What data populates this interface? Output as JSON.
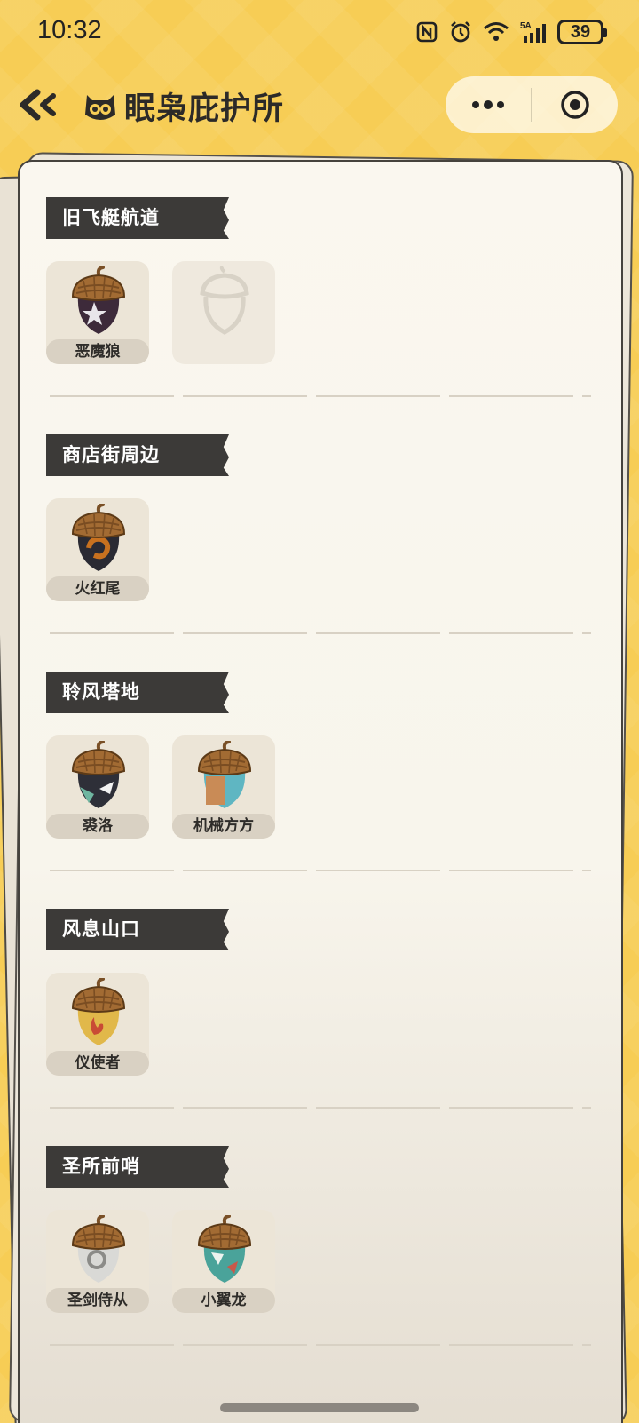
{
  "status_bar": {
    "time": "10:32",
    "signal_label": "5A",
    "battery": "39",
    "icons": [
      "nfc-icon",
      "alarm-icon",
      "wifi-icon",
      "cellular-icon",
      "battery-icon"
    ]
  },
  "header": {
    "title": "眠枭庇护所",
    "back_icon": "double-chevron-left-icon",
    "title_icon": "owl-icon",
    "capsule": {
      "more_icon": "more-dots-icon",
      "close_icon": "target-close-icon"
    }
  },
  "colors": {
    "background": "#f7cd55",
    "paper": "#f8f5ec",
    "section_tag": "#3c3a38",
    "card": "#ece5d7"
  },
  "sections": [
    {
      "title": "旧飞艇航道",
      "items": [
        {
          "name": "恶魔狼",
          "collected": true,
          "body_colors": [
            "#3d2a3a",
            "#6b2f3c"
          ],
          "emblem": "star"
        },
        {
          "name": "",
          "collected": false
        }
      ]
    },
    {
      "title": "商店街周边",
      "items": [
        {
          "name": "火红尾",
          "collected": true,
          "body_colors": [
            "#2a2a33",
            "#c8711f"
          ],
          "emblem": "swirl"
        }
      ]
    },
    {
      "title": "聆风塔地",
      "items": [
        {
          "name": "裘洛",
          "collected": true,
          "body_colors": [
            "#2e2f38",
            "#6fb6a0"
          ],
          "emblem": "cape"
        },
        {
          "name": "机械方方",
          "collected": true,
          "body_colors": [
            "#5fb6c2",
            "#c98b56"
          ],
          "emblem": "patch"
        }
      ]
    },
    {
      "title": "风息山口",
      "items": [
        {
          "name": "仪使者",
          "collected": true,
          "body_colors": [
            "#e1b84a",
            "#c94b35"
          ],
          "emblem": "flame"
        }
      ]
    },
    {
      "title": "圣所前哨",
      "items": [
        {
          "name": "圣剑侍从",
          "collected": true,
          "body_colors": [
            "#d9d9d6",
            "#8b8b88"
          ],
          "emblem": "ring"
        },
        {
          "name": "小翼龙",
          "collected": true,
          "body_colors": [
            "#4aa39a",
            "#c9584a"
          ],
          "emblem": "wing"
        }
      ]
    }
  ]
}
